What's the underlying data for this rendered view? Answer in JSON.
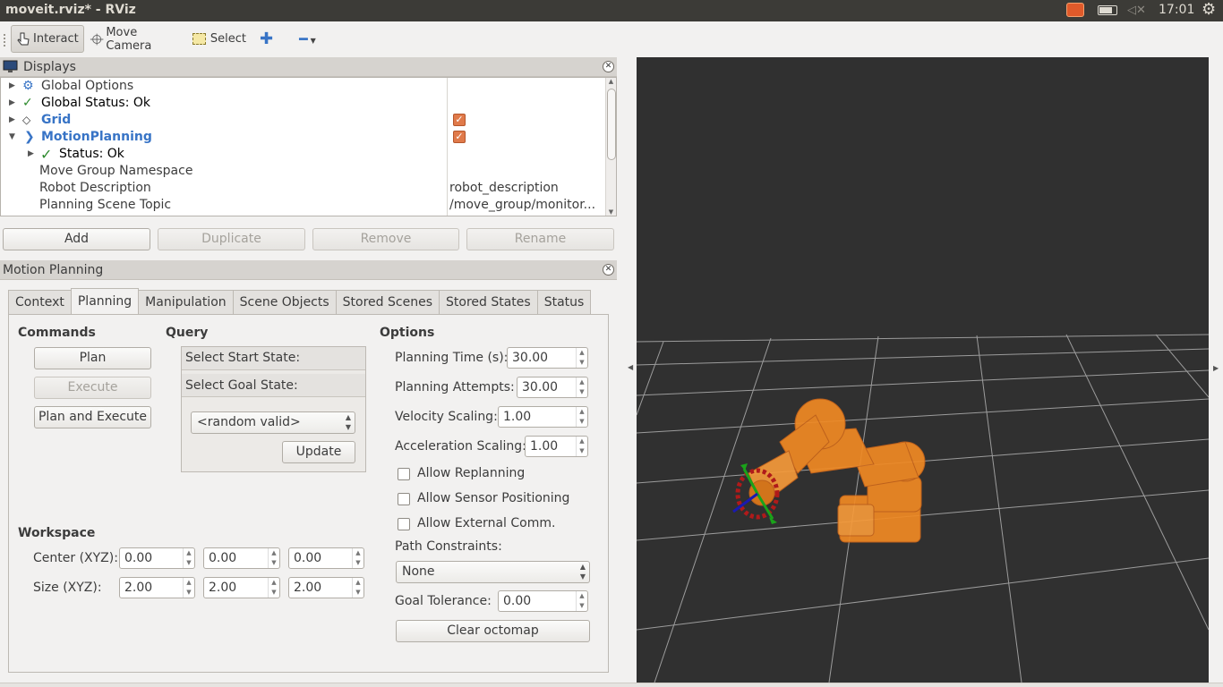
{
  "window": {
    "title": "moveit.rviz* - RViz",
    "clock": "17:01"
  },
  "toolbar": {
    "interact": "Interact",
    "move_camera": "Move Camera",
    "select": "Select"
  },
  "displays": {
    "title": "Displays",
    "items": [
      {
        "label": "Global Options"
      },
      {
        "label": "Global Status: Ok"
      },
      {
        "label": "Grid"
      },
      {
        "label": "MotionPlanning"
      },
      {
        "label": "Status: Ok"
      },
      {
        "label": "Move Group Namespace",
        "value": ""
      },
      {
        "label": "Robot Description",
        "value": "robot_description"
      },
      {
        "label": "Planning Scene Topic",
        "value": "/move_group/monitor..."
      }
    ],
    "buttons": {
      "add": "Add",
      "duplicate": "Duplicate",
      "remove": "Remove",
      "rename": "Rename"
    }
  },
  "motion_planning": {
    "title": "Motion Planning",
    "tabs": [
      "Context",
      "Planning",
      "Manipulation",
      "Scene Objects",
      "Stored Scenes",
      "Stored States",
      "Status"
    ],
    "active_tab": "Planning",
    "commands": {
      "heading": "Commands",
      "plan": "Plan",
      "execute": "Execute",
      "plan_execute": "Plan and Execute"
    },
    "query": {
      "heading": "Query",
      "start": "Select Start State:",
      "goal": "Select Goal State:",
      "goal_option": "<random valid>",
      "update": "Update"
    },
    "workspace": {
      "heading": "Workspace",
      "center_label": "Center (XYZ):",
      "center": [
        "0.00",
        "0.00",
        "0.00"
      ],
      "size_label": "Size (XYZ):",
      "size": [
        "2.00",
        "2.00",
        "2.00"
      ]
    },
    "options": {
      "heading": "Options",
      "planning_time_label": "Planning Time (s):",
      "planning_time": "30.00",
      "planning_attempts_label": "Planning Attempts:",
      "planning_attempts": "30.00",
      "velocity_label": "Velocity Scaling:",
      "velocity": "1.00",
      "accel_label": "Acceleration Scaling:",
      "accel": "1.00",
      "allow_replanning": "Allow Replanning",
      "allow_sensor": "Allow Sensor Positioning",
      "allow_external": "Allow External Comm.",
      "path_constraints_label": "Path Constraints:",
      "path_constraints": "None",
      "goal_tolerance_label": "Goal Tolerance:",
      "goal_tolerance": "0.00",
      "clear_octomap": "Clear octomap"
    }
  },
  "colors": {
    "accent": "#3874c6",
    "robot": "#f08a24",
    "viewport_bg": "#303030",
    "topbar": "#3c3b37"
  }
}
